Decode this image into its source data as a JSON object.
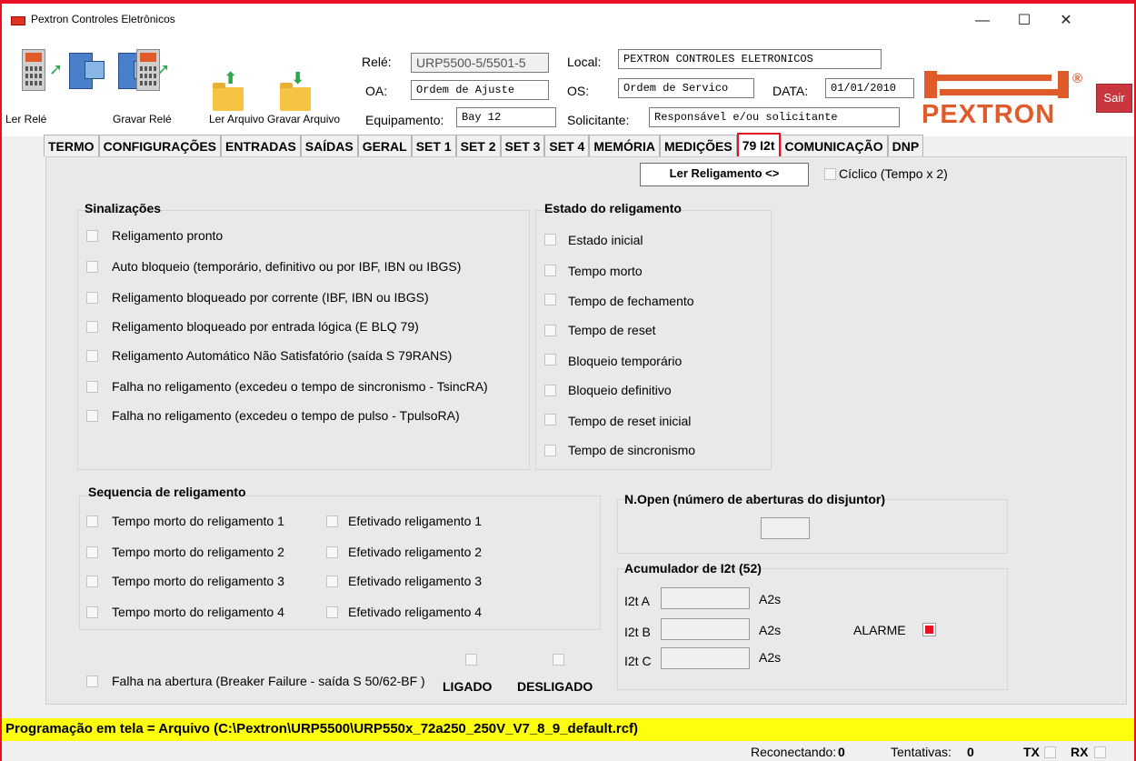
{
  "window": {
    "title": "Pextron Controles Eletrônicos",
    "minimize": "—",
    "maximize": "☐",
    "close": "✕"
  },
  "toolbar": {
    "ler_rele": "Ler Relé",
    "gravar_rele": "Gravar Relé",
    "ler_arquivo": "Ler Arquivo",
    "gravar_arquivo": "Gravar Arquivo"
  },
  "fields": {
    "rele_label": "Relé:",
    "rele_value": "URP5500-5/5501-5",
    "oa_label": "OA:",
    "oa_value": "Ordem de Ajuste",
    "equipamento_label": "Equipamento:",
    "equipamento_value": "Bay 12",
    "local_label": "Local:",
    "local_value": "PEXTRON CONTROLES ELETRONICOS",
    "os_label": "OS:",
    "os_value": "Ordem de Servico",
    "data_label": "DATA:",
    "data_value": "01/01/2010",
    "solicitante_label": "Solicitante:",
    "solicitante_value": "Responsável e/ou solicitante"
  },
  "logo": {
    "word": "PEXTRON",
    "reg": "®"
  },
  "sair": "Sair",
  "tabs": [
    "TERMO",
    "CONFIGURAÇÕES",
    "ENTRADAS",
    "SAÍDAS",
    "GERAL",
    "SET 1",
    "SET 2",
    "SET 3",
    "SET 4",
    "MEMÓRIA",
    "MEDIÇÕES",
    "79 I2t",
    "COMUNICAÇÃO",
    "DNP"
  ],
  "active_tab": "79 I2t",
  "panel": {
    "ler_religamento": "Ler Religamento <>",
    "ciclico": "Cíclico (Tempo x 2)",
    "sinalizacoes": {
      "title": "Sinalizações",
      "items": [
        "Religamento pronto",
        "Auto bloqueio (temporário, definitivo ou por IBF, IBN ou IBGS)",
        "Religamento bloqueado por corrente (IBF, IBN ou IBGS)",
        "Religamento bloqueado por entrada lógica (E BLQ 79)",
        "Religamento Automático Não Satisfatório (saída S 79RANS)",
        "Falha no religamento (excedeu o tempo de sincronismo - TsincRA)",
        "Falha no religamento (excedeu o tempo de pulso - TpulsoRA)"
      ]
    },
    "estado": {
      "title": "Estado do religamento",
      "items": [
        "Estado inicial",
        "Tempo morto",
        "Tempo de fechamento",
        "Tempo de reset",
        "Bloqueio temporário",
        "Bloqueio definitivo",
        "Tempo de reset inicial",
        "Tempo de sincronismo"
      ]
    },
    "sequencia": {
      "title": "Sequencia de religamento",
      "left": [
        "Tempo morto do religamento 1",
        "Tempo morto do religamento 2",
        "Tempo morto do religamento 3",
        "Tempo morto do religamento 4"
      ],
      "right": [
        "Efetivado religamento 1",
        "Efetivado religamento 2",
        "Efetivado religamento 3",
        "Efetivado religamento 4"
      ]
    },
    "breaker_failure": "Falha na abertura (Breaker Failure - saída S 50/62-BF )",
    "ligado": "LIGADO",
    "desligado": "DESLIGADO",
    "nopen": {
      "title": "N.Open (número de aberturas do disjuntor)"
    },
    "acumulador": {
      "title": "Acumulador de I2t (52)",
      "rows": [
        {
          "label": "I2t A",
          "unit": "A2s"
        },
        {
          "label": "I2t B",
          "unit": "A2s"
        },
        {
          "label": "I2t C",
          "unit": "A2s"
        }
      ],
      "alarme": "ALARME"
    }
  },
  "statusbar": "Programação em tela = Arquivo (C:\\Pextron\\URP5500\\URP550x_72a250_250V_V7_8_9_default.rcf)",
  "bottombar": {
    "reconectando_label": "Reconectando:",
    "reconectando_value": "0",
    "tentativas_label": "Tentativas:",
    "tentativas_value": "0",
    "tx": "TX",
    "rx": "RX"
  },
  "colors": {
    "accent": "#e81123",
    "logo": "#e05a2a",
    "statusbar": "#ffff0d",
    "sair": "#c9363d"
  }
}
